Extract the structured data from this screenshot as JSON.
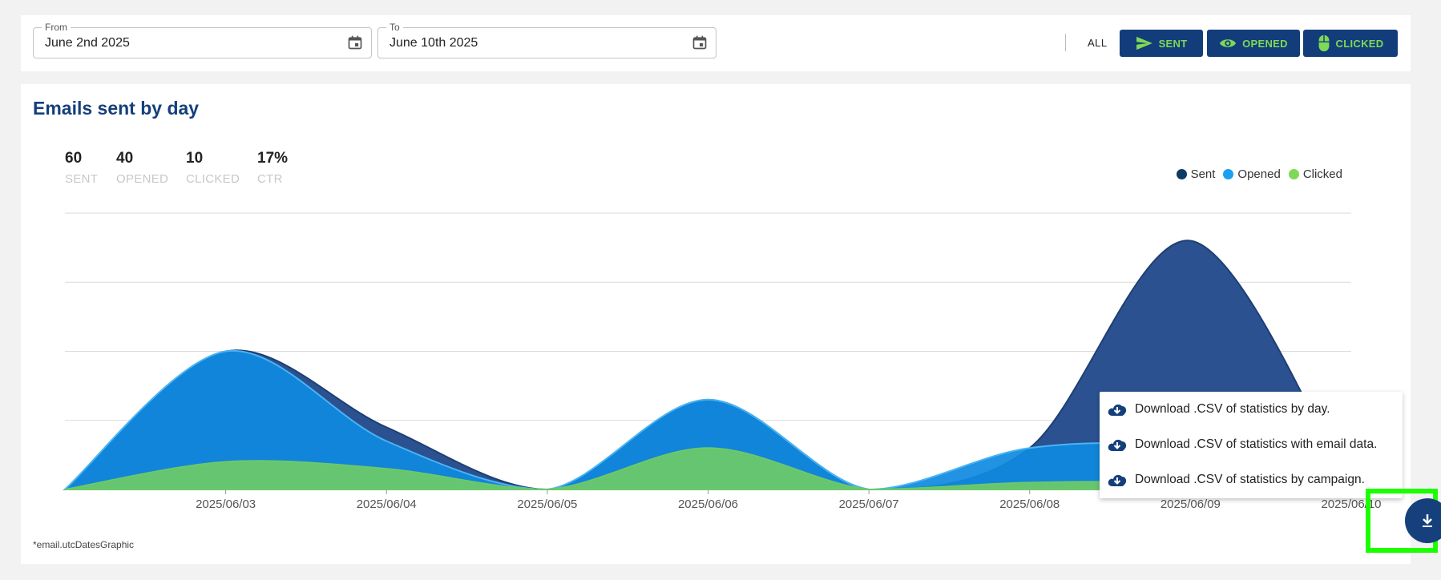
{
  "filters": {
    "from": {
      "label": "From",
      "value": "June 2nd 2025"
    },
    "to": {
      "label": "To",
      "value": "June 10th 2025"
    },
    "all_label": "ALL",
    "sent_label": "SENT",
    "opened_label": "OPENED",
    "clicked_label": "CLICKED"
  },
  "panel": {
    "title": "Emails sent by day",
    "footnote": "*email.utcDatesGraphic"
  },
  "stats": [
    {
      "value": "60",
      "caption": "SENT"
    },
    {
      "value": "40",
      "caption": "OPENED"
    },
    {
      "value": "10",
      "caption": "CLICKED"
    },
    {
      "value": "17%",
      "caption": "CTR"
    }
  ],
  "legend": [
    {
      "name": "Sent",
      "color": "#0d3b66"
    },
    {
      "name": "Opened",
      "color": "#1aa0f0"
    },
    {
      "name": "Clicked",
      "color": "#7ed957"
    }
  ],
  "download_menu": {
    "items": [
      "Download .CSV of statistics by day.",
      "Download .CSV of statistics with email data.",
      "Download .CSV of statistics by campaign."
    ]
  },
  "colors": {
    "accent": "#153f7a",
    "sent": "#2b5190",
    "opened": "#0f8ae0",
    "clicked": "#6cc86a",
    "highlight": "#1cff00"
  },
  "chart_data": {
    "type": "area",
    "x": [
      "2025/06/02",
      "2025/06/03",
      "2025/06/04",
      "2025/06/05",
      "2025/06/06",
      "2025/06/07",
      "2025/06/08",
      "2025/06/09",
      "2025/06/10"
    ],
    "tick_labels": [
      "2025/06/03",
      "2025/06/04",
      "2025/06/05",
      "2025/06/06",
      "2025/06/07",
      "2025/06/08",
      "2025/06/09",
      "2025/06/10"
    ],
    "ylim": [
      0,
      40
    ],
    "grid": true,
    "legend_position": "top-right",
    "series": [
      {
        "name": "Sent",
        "values": [
          0,
          20,
          9,
          0,
          13,
          0,
          6,
          36,
          0
        ]
      },
      {
        "name": "Opened",
        "values": [
          0,
          20,
          7,
          0,
          13,
          0,
          6,
          6,
          0
        ]
      },
      {
        "name": "Clicked",
        "values": [
          0,
          4,
          3,
          0,
          6,
          0,
          1,
          1,
          0
        ]
      }
    ]
  }
}
